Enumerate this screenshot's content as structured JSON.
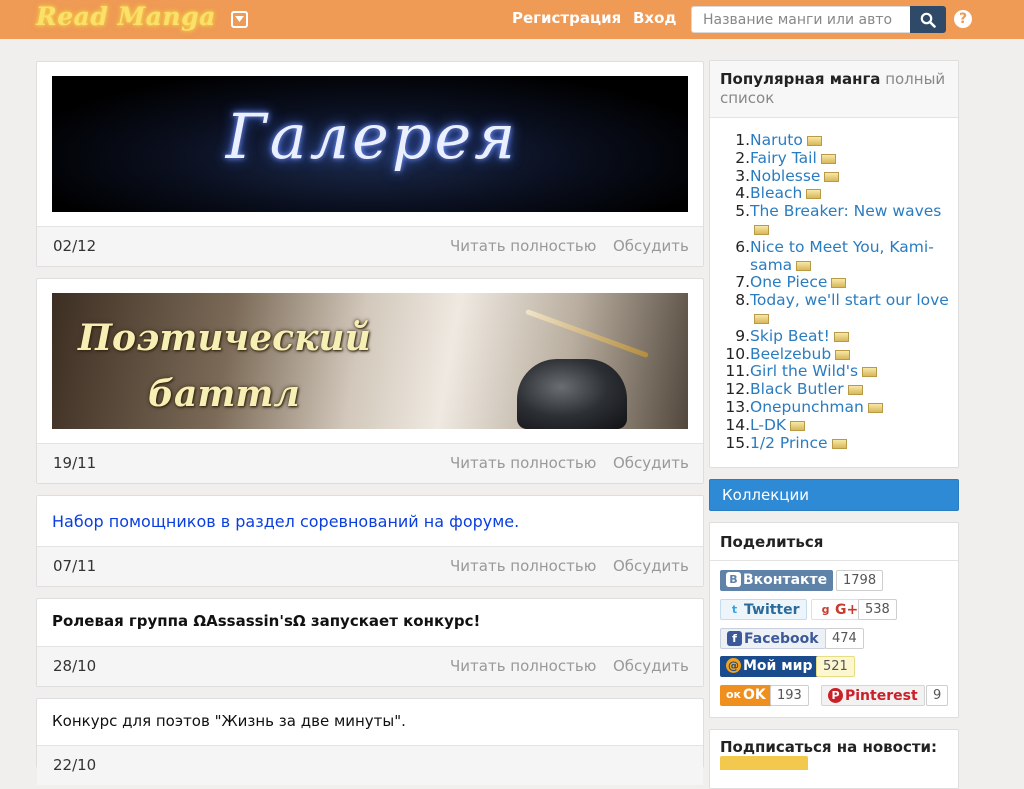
{
  "header": {
    "logo_text": "Read Manga",
    "register_label": "Регистрация",
    "login_label": "Вход",
    "search_placeholder": "Название манги или авто",
    "help_label": "?"
  },
  "news": [
    {
      "banner_text": "Галерея",
      "date": "02/12",
      "read_label": "Читать полностью",
      "discuss_label": "Обсудить"
    },
    {
      "banner_line1": "Поэтический",
      "banner_line2": "баттл",
      "date": "19/11",
      "read_label": "Читать полностью",
      "discuss_label": "Обсудить"
    },
    {
      "text": "Набор помощников в раздел соревнований на форуме.",
      "date": "07/11",
      "read_label": "Читать полностью",
      "discuss_label": "Обсудить"
    },
    {
      "text": "Ролевая группа ΩAssassin'sΩ запускает конкурс!",
      "date": "28/10",
      "read_label": "Читать полностью",
      "discuss_label": "Обсудить"
    },
    {
      "text": "Конкурс для поэтов \"Жизнь за две минуты\".",
      "date": "22/10"
    }
  ],
  "sidebar": {
    "popular": {
      "title": "Популярная манга",
      "full_list_label": "полный список",
      "items": [
        {
          "num": "1.",
          "name": "Naruto"
        },
        {
          "num": "2.",
          "name": "Fairy Tail"
        },
        {
          "num": "3.",
          "name": "Noblesse"
        },
        {
          "num": "4.",
          "name": "Bleach"
        },
        {
          "num": "5.",
          "name": "The Breaker: New waves"
        },
        {
          "num": "6.",
          "name": "Nice to Meet You, Kami-sama"
        },
        {
          "num": "7.",
          "name": "One Piece"
        },
        {
          "num": "8.",
          "name": "Today, we'll start our love"
        },
        {
          "num": "9.",
          "name": "Skip Beat!"
        },
        {
          "num": "10.",
          "name": "Beelzebub"
        },
        {
          "num": "11.",
          "name": "Girl the Wild's"
        },
        {
          "num": "12.",
          "name": "Black Butler"
        },
        {
          "num": "13.",
          "name": "Onepunchman"
        },
        {
          "num": "14.",
          "name": "L-DK"
        },
        {
          "num": "15.",
          "name": "1/2 Prince"
        }
      ]
    },
    "collections_label": "Коллекции",
    "share": {
      "title": "Поделиться",
      "vk": {
        "label": "Вконтакте",
        "icon": "В",
        "count": "1798"
      },
      "twitter": {
        "label": "Twitter",
        "icon": "t"
      },
      "gplus": {
        "label": "G+",
        "icon": "g",
        "count": "538"
      },
      "facebook": {
        "label": "Facebook",
        "icon": "f",
        "count": "474"
      },
      "moimir": {
        "label": "Мой мир",
        "icon": "@",
        "count": "521"
      },
      "ok": {
        "label": "OK",
        "icon": "ок",
        "count": "193"
      },
      "pinterest": {
        "label": "Pinterest",
        "icon": "P",
        "count": "9"
      }
    },
    "subscribe_title": "Подписаться на новости:"
  },
  "colors": {
    "topbar": "#ef9a55",
    "link_blue": "#2a7cc0",
    "collections_blue": "#2f8ad6",
    "news_link": "#0b3ee0"
  }
}
